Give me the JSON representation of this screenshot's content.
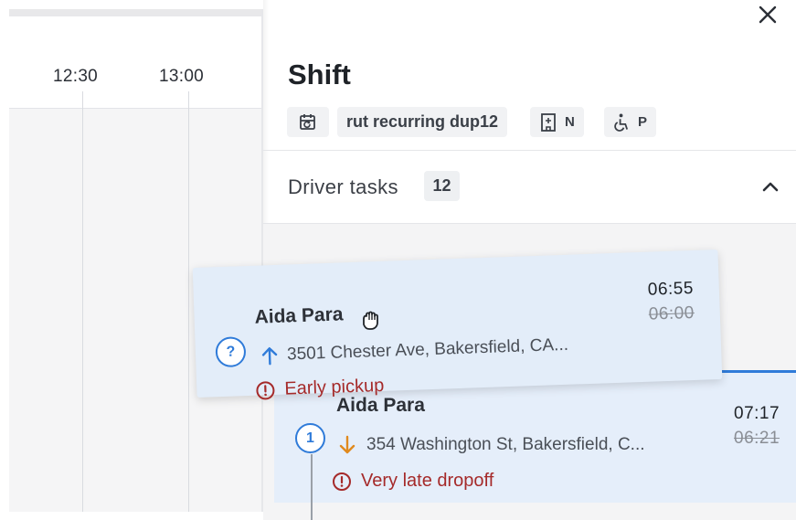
{
  "timeline": {
    "time_labels": [
      "12:30",
      "13:00"
    ]
  },
  "panel": {
    "title": "Shift",
    "close_icon": "close-icon",
    "chips": [
      {
        "icon": "calendar-recurring-icon",
        "label": ""
      },
      {
        "icon": "",
        "label": "rut recurring dup12"
      },
      {
        "icon": "building-icon",
        "label": "N"
      },
      {
        "icon": "wheelchair-icon",
        "label": "P"
      }
    ],
    "section": {
      "title": "Driver tasks",
      "count": "12",
      "collapse_icon": "chevron-up-icon"
    }
  },
  "tasks": [
    {
      "marker": "?",
      "name": "Aida Para",
      "direction": "pickup",
      "direction_icon": "arrow-up-icon",
      "address": "3501 Chester Ave, Bakersfield, CA...",
      "time": "06:55",
      "original_time": "06:00",
      "warning": "Early pickup",
      "state": "dragging"
    },
    {
      "marker": "1",
      "name": "Aida Para",
      "direction": "dropoff",
      "direction_icon": "arrow-down-icon",
      "address": "354 Washington St, Bakersfield, C...",
      "time": "07:17",
      "original_time": "06:21",
      "warning": "Very late dropoff",
      "state": "idle"
    }
  ],
  "colors": {
    "accent": "#2f7bd9",
    "pickup_arrow": "#2f7bd9",
    "dropoff_arrow": "#e08a1e",
    "warning": "#a52a2a",
    "card_bg": "#e3edf9"
  },
  "cursor": "grab-hand-icon"
}
